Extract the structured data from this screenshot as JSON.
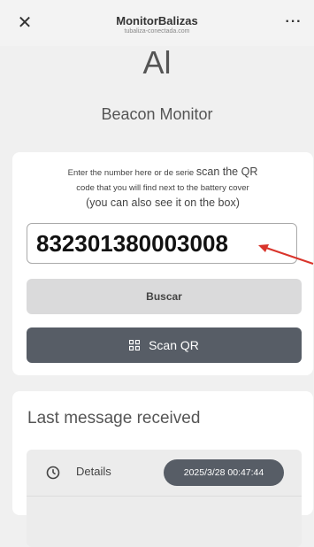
{
  "header": {
    "close_icon": "close-icon",
    "title": "MonitorBalizas",
    "url": "tubaliza-conectada.com",
    "more_icon": "more-dots-icon"
  },
  "logo_text": "Al",
  "page_title": "Beacon Monitor",
  "search_card": {
    "instructions_line1_a": "Enter the number here or",
    "instructions_line1_b": "de serie",
    "instructions_line1_c": "scan the QR",
    "instructions_line2": "code that you will find next to the battery cover",
    "instructions_line3": "(you can also see it on the box)",
    "number_value": "832301380003008",
    "search_button": "Buscar",
    "scan_button": "Scan QR",
    "scan_icon": "qr-code-icon"
  },
  "last_message": {
    "title": "Last message received",
    "details_label": "Details",
    "details_icon": "clock-icon",
    "timestamp": "2025/3/28 00:47:44"
  },
  "colors": {
    "dark_button": "#575d66",
    "light_button": "#dadadb",
    "annotation_arrow": "#d9342b",
    "background": "#f0f0f0"
  }
}
